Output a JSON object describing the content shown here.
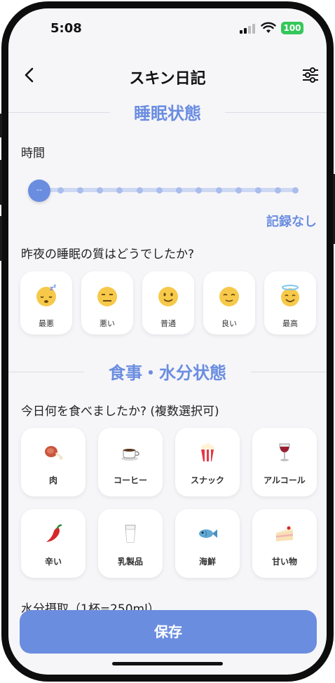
{
  "status_bar": {
    "time": "5:08",
    "battery": "100"
  },
  "header": {
    "title": "スキン日記"
  },
  "sleep_section": {
    "title": "睡眠状態",
    "time_label": "時間",
    "slider_value_text": "--",
    "no_record": "記録なし",
    "quality_question": "昨夜の睡眠の質はどうでしたか?",
    "quality_options": [
      {
        "label": "最悪",
        "icon": "sleeping-face-icon"
      },
      {
        "label": "悪い",
        "icon": "expressionless-face-icon"
      },
      {
        "label": "普通",
        "icon": "slightly-smiling-face-icon"
      },
      {
        "label": "良い",
        "icon": "relieved-face-icon"
      },
      {
        "label": "最高",
        "icon": "halo-face-icon"
      }
    ]
  },
  "food_section": {
    "title": "食事・水分状態",
    "question": "今日何を食べましたか? (複数選択可)",
    "options": [
      {
        "label": "肉",
        "icon": "meat-icon"
      },
      {
        "label": "コーヒー",
        "icon": "coffee-icon"
      },
      {
        "label": "スナック",
        "icon": "popcorn-icon"
      },
      {
        "label": "アルコール",
        "icon": "wine-icon"
      },
      {
        "label": "辛い",
        "icon": "chili-icon"
      },
      {
        "label": "乳製品",
        "icon": "milk-icon"
      },
      {
        "label": "海鮮",
        "icon": "fish-icon"
      },
      {
        "label": "甘い物",
        "icon": "cake-icon"
      }
    ],
    "water_label": "水分摂取（1杯=250ml）"
  },
  "save_button": "保存",
  "colors": {
    "accent": "#6b8de0",
    "battery": "#34c759",
    "background": "#f6f6f9"
  }
}
